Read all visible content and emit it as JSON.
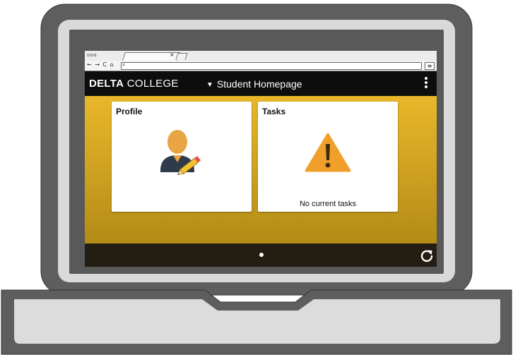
{
  "browser": {
    "window_controls": "ooo",
    "tab_close": "×",
    "nav_buttons": "← → C ⌂",
    "search_icon": "search-icon",
    "menu_icon": "hamburger-menu-icon"
  },
  "header": {
    "brand_bold": "DELTA",
    "brand_rest": " COLLEGE",
    "page_title": "Student Homepage",
    "caret_icon": "caret-down-icon",
    "actions_icon": "kebab-menu-icon"
  },
  "tiles": [
    {
      "title": "Profile",
      "icon": "user-edit-icon",
      "status": ""
    },
    {
      "title": "Tasks",
      "icon": "warning-icon",
      "status": "No current tasks"
    }
  ],
  "footer": {
    "page_indicator": {
      "current": 1,
      "total": 1
    },
    "refresh_icon": "refresh-icon"
  },
  "colors": {
    "content_gradient_top": "#e9b72a",
    "content_gradient_bottom": "#b38b16",
    "header_bg": "#0d0d0d",
    "footer_bg": "#231d12",
    "warning_orange": "#f0a02a",
    "laptop_frame": "#5e5e5e"
  }
}
